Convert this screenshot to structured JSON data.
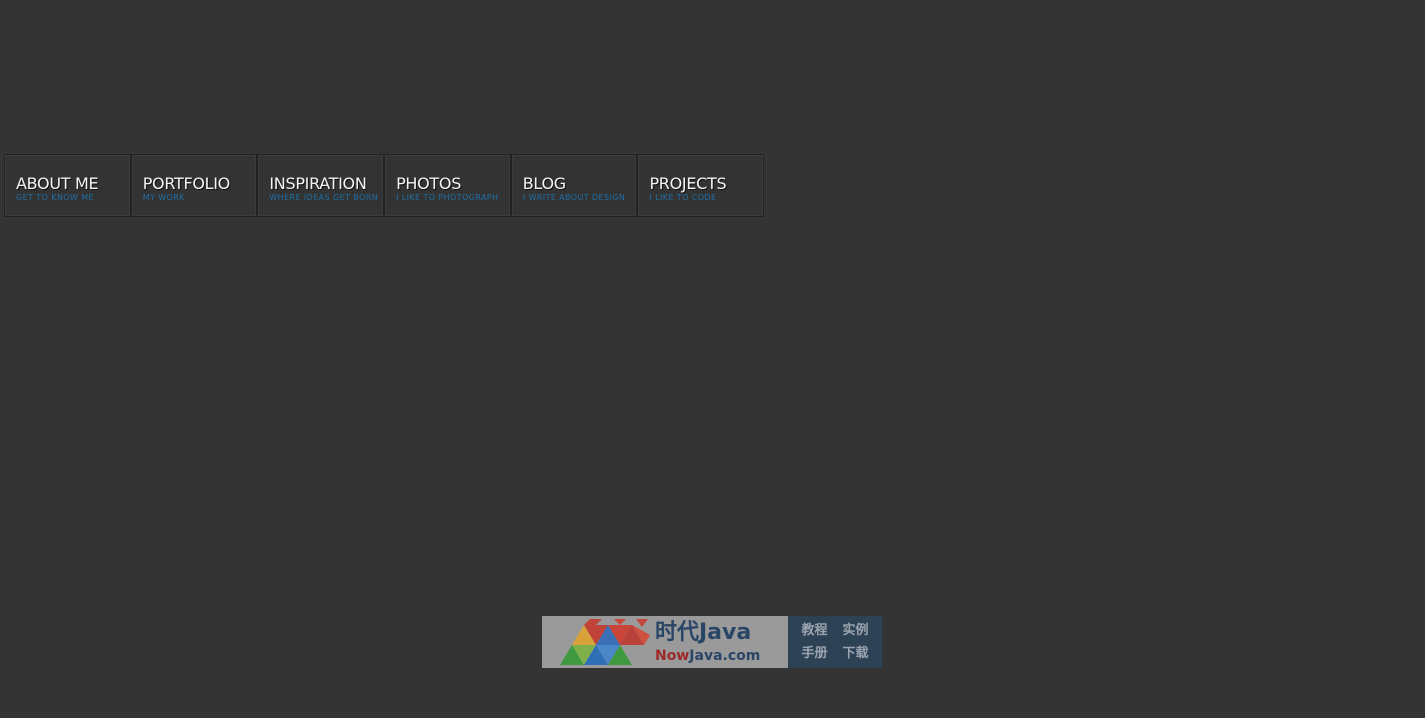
{
  "nav": {
    "items": [
      {
        "title": "ABOUT ME",
        "subtitle": "GET TO KNOW ME"
      },
      {
        "title": "PORTFOLIO",
        "subtitle": "MY WORK"
      },
      {
        "title": "INSPIRATION",
        "subtitle": "WHERE IDEAS GET BORN"
      },
      {
        "title": "PHOTOS",
        "subtitle": "I LIKE TO PHOTOGRAPH"
      },
      {
        "title": "BLOG",
        "subtitle": "I WRITE ABOUT DESIGN"
      },
      {
        "title": "PROJECTS",
        "subtitle": "I LIKE TO CODE"
      }
    ]
  },
  "banner": {
    "brand_main": "时代Java",
    "brand_now": "Now",
    "brand_rest": "Java.com",
    "links": [
      "教程",
      "实例",
      "手册",
      "下载"
    ]
  },
  "colors": {
    "background": "#343434",
    "nav_title": "#f4f4f4",
    "nav_subtitle": "#1f6fa8",
    "banner_right": "#2e4256"
  }
}
